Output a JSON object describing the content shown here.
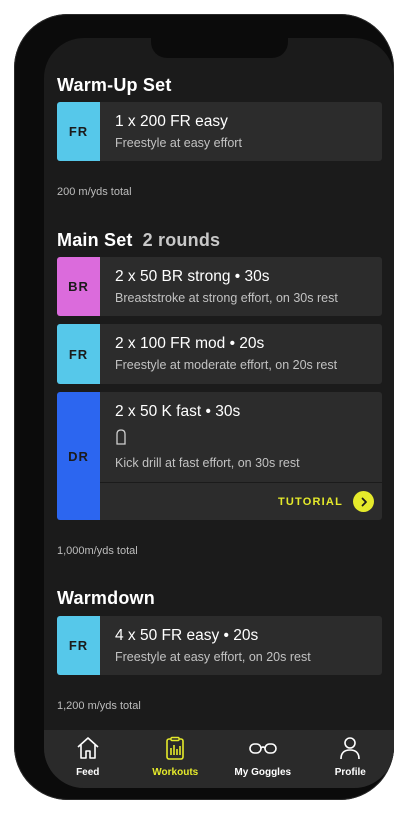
{
  "warmup": {
    "title": "Warm-Up Set",
    "items": [
      {
        "badge": "FR",
        "color": "#56c8ea",
        "title": "1 x 200 FR easy",
        "subtitle": "Freestyle at easy effort"
      }
    ],
    "total": "200 m/yds total"
  },
  "main": {
    "title": "Main Set",
    "rounds": "2 rounds",
    "items": [
      {
        "badge": "BR",
        "color": "#db6bdc",
        "title": "2 x 50 BR strong • 30s",
        "subtitle": "Breaststroke at strong effort, on 30s rest"
      },
      {
        "badge": "FR",
        "color": "#56c8ea",
        "title": "2 x 100 FR mod • 20s",
        "subtitle": "Freestyle at moderate effort, on 20s rest"
      },
      {
        "badge": "DR",
        "color": "#2c66f0",
        "title": "2 x 50 K fast • 30s",
        "equipment_icon": "kickboard-icon",
        "subtitle": "Kick drill at fast effort, on 30s rest",
        "tutorial_label": "TUTORIAL"
      }
    ],
    "total": "1,000m/yds total"
  },
  "warmdown": {
    "title": "Warmdown",
    "items": [
      {
        "badge": "FR",
        "color": "#56c8ea",
        "title": "4 x 50 FR easy • 20s",
        "subtitle": "Freestyle at easy effort, on 20s rest"
      }
    ],
    "total": "1,200 m/yds total"
  },
  "tabs": [
    {
      "label": "Feed",
      "icon": "home-icon",
      "active": false
    },
    {
      "label": "Workouts",
      "icon": "clipboard-chart-icon",
      "active": true
    },
    {
      "label": "My Goggles",
      "icon": "goggles-icon",
      "active": false
    },
    {
      "label": "Profile",
      "icon": "person-icon",
      "active": false
    }
  ],
  "colors": {
    "accent": "#e5ea2b",
    "background": "#1b1b1b",
    "card": "#2c2c2c",
    "freestyle": "#56c8ea",
    "breaststroke": "#db6bdc",
    "drill": "#2c66f0"
  }
}
